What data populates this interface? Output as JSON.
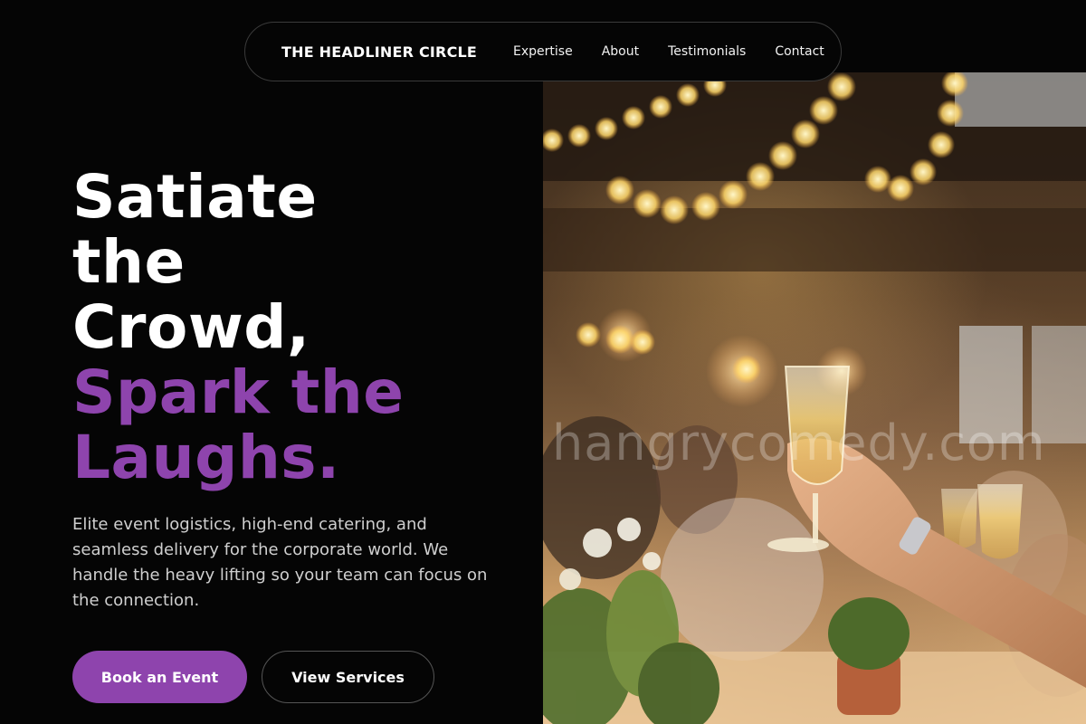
{
  "nav": {
    "brand": "THE HEADLINER CIRCLE",
    "links": [
      "Expertise",
      "About",
      "Testimonials",
      "Contact"
    ]
  },
  "hero": {
    "headline_white": [
      "Satiate",
      "the",
      "Crowd,"
    ],
    "headline_accent": [
      "Spark the",
      "Laughs."
    ],
    "description": "Elite event logistics, high-end catering, and seamless delivery for the corporate world. We handle the heavy lifting so your team can focus on the connection.",
    "primary_cta": "Book an Event",
    "secondary_cta": "View Services"
  },
  "image": {
    "subject": "guests raising champagne glasses at a banquet under string lights",
    "watermark": "hangrycomedy.com"
  },
  "colors": {
    "background": "#050505",
    "accent": "#8e44ad",
    "text": "#ffffff",
    "muted": "#cfcfcf"
  }
}
